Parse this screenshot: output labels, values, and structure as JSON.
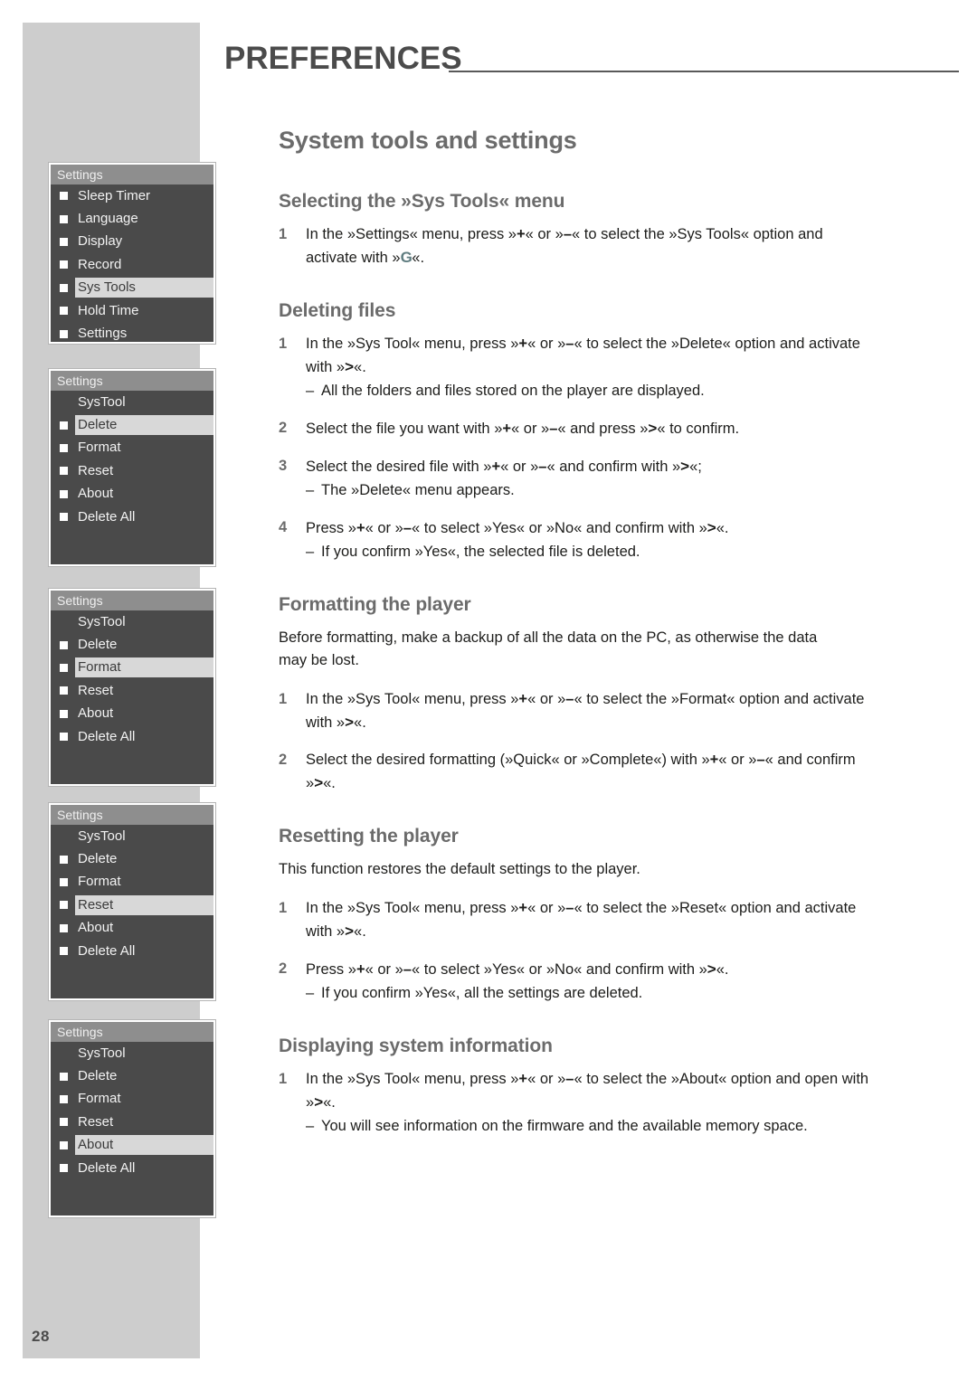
{
  "page": {
    "number": "28",
    "running_head": "PREFERENCES",
    "title": "System tools and settings"
  },
  "glyphs": {
    "enter": "G",
    "arrow": ">",
    "plus": "+",
    "minus": "–"
  },
  "menus": [
    {
      "name": "settings-menu-sys-tools",
      "header": "Settings",
      "rows": [
        {
          "label": "Sleep Timer",
          "bullet": true,
          "selected": false
        },
        {
          "label": "Language",
          "bullet": true,
          "selected": false
        },
        {
          "label": "Display",
          "bullet": true,
          "selected": false
        },
        {
          "label": "Record",
          "bullet": true,
          "selected": false
        },
        {
          "label": "Sys Tools",
          "bullet": true,
          "selected": true
        },
        {
          "label": "Hold Time",
          "bullet": true,
          "selected": false
        },
        {
          "label": "Settings",
          "bullet": true,
          "selected": false
        }
      ]
    },
    {
      "name": "systool-menu-delete",
      "header": "Settings",
      "rows": [
        {
          "label": "SysTool",
          "bullet": false,
          "selected": false
        },
        {
          "label": "Delete",
          "bullet": true,
          "selected": true
        },
        {
          "label": "Format",
          "bullet": true,
          "selected": false
        },
        {
          "label": "Reset",
          "bullet": true,
          "selected": false
        },
        {
          "label": "About",
          "bullet": true,
          "selected": false
        },
        {
          "label": "Delete All",
          "bullet": true,
          "selected": false
        }
      ]
    },
    {
      "name": "systool-menu-format",
      "header": "Settings",
      "rows": [
        {
          "label": "SysTool",
          "bullet": false,
          "selected": false
        },
        {
          "label": "Delete",
          "bullet": true,
          "selected": false
        },
        {
          "label": "Format",
          "bullet": true,
          "selected": true
        },
        {
          "label": "Reset",
          "bullet": true,
          "selected": false
        },
        {
          "label": "About",
          "bullet": true,
          "selected": false
        },
        {
          "label": "Delete All",
          "bullet": true,
          "selected": false
        }
      ]
    },
    {
      "name": "systool-menu-reset",
      "header": "Settings",
      "rows": [
        {
          "label": "SysTool",
          "bullet": false,
          "selected": false
        },
        {
          "label": "Delete",
          "bullet": true,
          "selected": false
        },
        {
          "label": "Format",
          "bullet": true,
          "selected": false
        },
        {
          "label": "Reset",
          "bullet": true,
          "selected": true
        },
        {
          "label": "About",
          "bullet": true,
          "selected": false
        },
        {
          "label": "Delete All",
          "bullet": true,
          "selected": false
        }
      ]
    },
    {
      "name": "systool-menu-about",
      "header": "Settings",
      "rows": [
        {
          "label": "SysTool",
          "bullet": false,
          "selected": false
        },
        {
          "label": "Delete",
          "bullet": true,
          "selected": false
        },
        {
          "label": "Format",
          "bullet": true,
          "selected": false
        },
        {
          "label": "Reset",
          "bullet": true,
          "selected": false
        },
        {
          "label": "About",
          "bullet": true,
          "selected": true
        },
        {
          "label": "Delete All",
          "bullet": true,
          "selected": false
        }
      ]
    }
  ],
  "sections": {
    "selecting": {
      "title": "Selecting the »Sys Tools« menu",
      "step1_a": "In the »Settings« menu, press »",
      "step1_b": "« or »",
      "step1_c": "« to select the »Sys Tools« option and activate with »",
      "step1_d": "«."
    },
    "deleting": {
      "title": "Deleting files",
      "step1_a": "In the »Sys Tool« menu, press »",
      "step1_b": "« or »",
      "step1_c": "« to select the »Delete« option and activate with »",
      "step1_d": "«.",
      "step1_sub": "All the folders and files stored on the player are displayed.",
      "step2_a": "Select the file you want with »",
      "step2_b": "« or »",
      "step2_c": "« and press »",
      "step2_d": "« to confirm.",
      "step3_a": "Select the desired file with »",
      "step3_b": "« or »",
      "step3_c": "« and confirm with »",
      "step3_d": "«;",
      "step3_sub": "The »Delete« menu appears.",
      "step4_a": "Press »",
      "step4_b": "« or »",
      "step4_c": "« to select »Yes« or »No« and confirm with »",
      "step4_d": "«.",
      "step4_sub": "If you confirm »Yes«, the selected file is deleted."
    },
    "formatting": {
      "title": "Formatting the player",
      "intro": "Before formatting, make a backup of all the data on the PC, as otherwise the data may be lost.",
      "step1_a": "In the »Sys Tool« menu, press »",
      "step1_b": "« or »",
      "step1_c": "« to select the »Format« option and activate with »",
      "step1_d": "«.",
      "step2_a": "Select the desired formatting (»Quick« or »Complete«) with »",
      "step2_b": "« or »",
      "step2_c": "« and confirm »",
      "step2_d": "«."
    },
    "resetting": {
      "title": "Resetting the player",
      "intro": "This function restores the default settings to the player.",
      "step1_a": "In the »Sys Tool« menu, press »",
      "step1_b": "« or »",
      "step1_c": "« to select the »Reset« option and activate with »",
      "step1_d": "«.",
      "step2_a": "Press »",
      "step2_b": "« or »",
      "step2_c": "« to select »Yes« or »No« and confirm with »",
      "step2_d": "«.",
      "step2_sub": "If you confirm »Yes«, all the settings are deleted."
    },
    "displaying": {
      "title": "Displaying system information",
      "step1_a": "In the »Sys Tool« menu, press »",
      "step1_b": "« or »",
      "step1_c": "« to select the »About« option and open with »",
      "step1_d": "«.",
      "step1_sub": "You will see information on the firmware and the available memory space."
    }
  },
  "numbers": {
    "n1": "1",
    "n2": "2",
    "n3": "3",
    "n4": "4"
  },
  "dash": "–",
  "colors": {
    "band": "#cdcdcd",
    "heading": "#6b6b6b",
    "body": "#1d1d1b",
    "menu_bg": "#4a4a4a",
    "menu_header": "#8e8e8e",
    "menu_selected": "#d8d8d8",
    "enter_glyph": "#5f7d80"
  }
}
